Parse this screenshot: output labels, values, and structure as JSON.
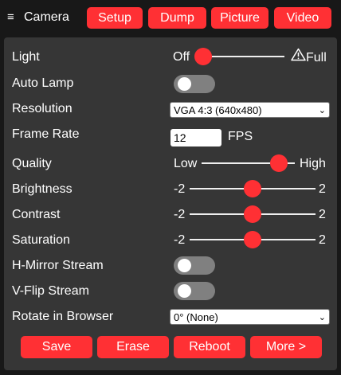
{
  "header": {
    "menu_icon": "hamburger-icon",
    "title": "Camera",
    "buttons": [
      "Setup",
      "Dump",
      "Picture",
      "Video"
    ]
  },
  "accent_color": "#ff3034",
  "settings": {
    "light": {
      "label": "Light",
      "min_label": "Off",
      "max_label": "Full",
      "warning_icon": "warning-icon",
      "value_fraction": 0.0
    },
    "auto_lamp": {
      "label": "Auto Lamp",
      "on": false
    },
    "resolution": {
      "label": "Resolution",
      "value": "VGA 4:3 (640x480)"
    },
    "frame_rate": {
      "label": "Frame Rate",
      "value": "12",
      "unit": "FPS"
    },
    "quality": {
      "label": "Quality",
      "min_label": "Low",
      "max_label": "High",
      "value_fraction": 1.0
    },
    "brightness": {
      "label": "Brightness",
      "min_label": "-2",
      "max_label": "2",
      "value": 0
    },
    "contrast": {
      "label": "Contrast",
      "min_label": "-2",
      "max_label": "2",
      "value": 0
    },
    "saturation": {
      "label": "Saturation",
      "min_label": "-2",
      "max_label": "2",
      "value": 0
    },
    "h_mirror": {
      "label": "H-Mirror Stream",
      "on": false
    },
    "v_flip": {
      "label": "V-Flip Stream",
      "on": false
    },
    "rotate": {
      "label": "Rotate in Browser",
      "value": "0° (None)"
    }
  },
  "footer": {
    "buttons": [
      "Save",
      "Erase",
      "Reboot",
      "More >"
    ]
  }
}
